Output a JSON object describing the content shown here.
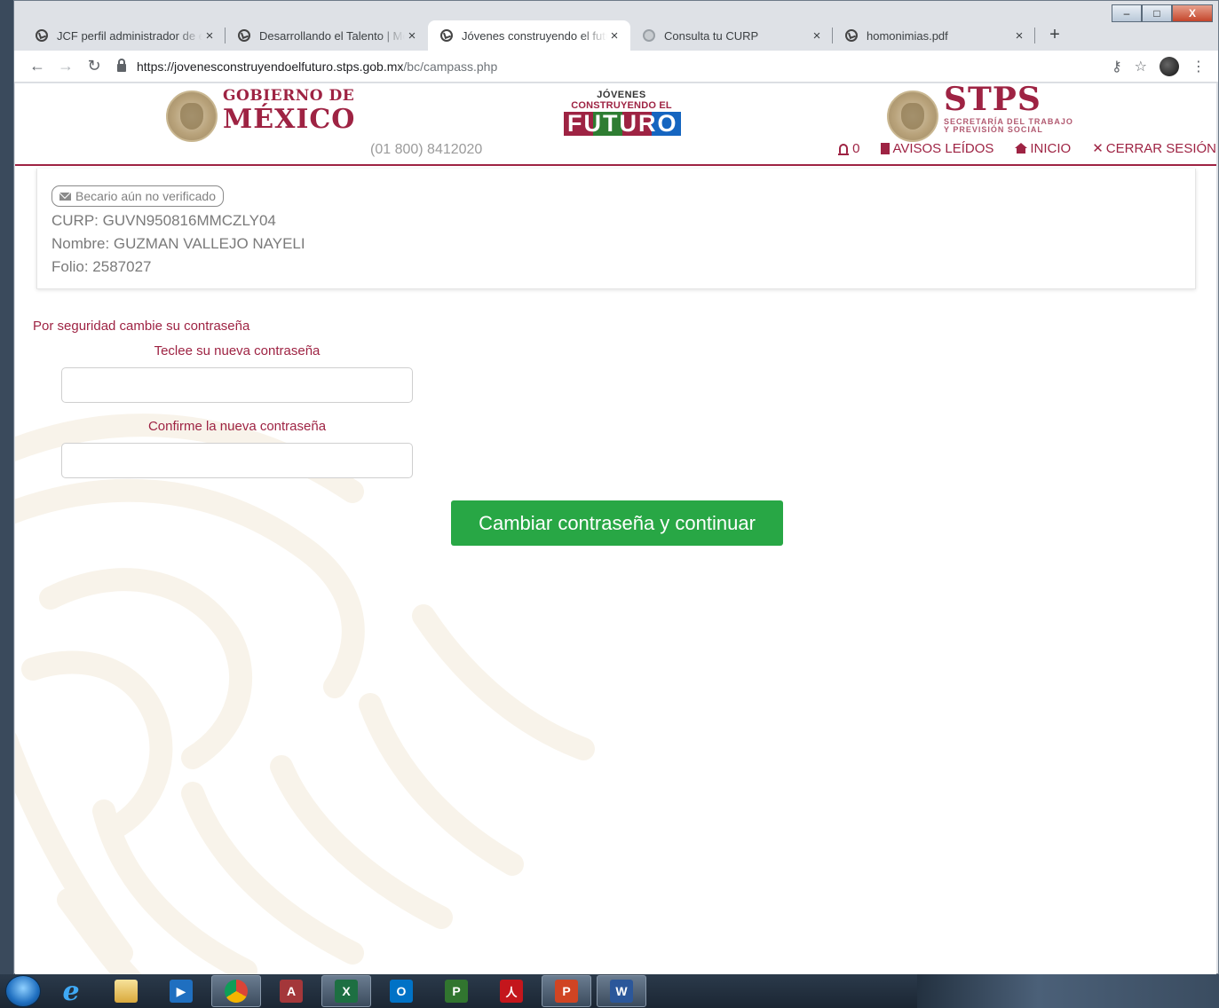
{
  "browser": {
    "tabs": [
      {
        "title": "JCF perfil administrador de e",
        "icon": "globe-check-icon",
        "active": false
      },
      {
        "title": "Desarrollando el Talento | Me",
        "icon": "globe-check-icon",
        "active": false
      },
      {
        "title": "Jóvenes construyendo el futu",
        "icon": "globe-check-icon",
        "active": true
      },
      {
        "title": "Consulta tu CURP",
        "icon": "gov-seal-icon",
        "active": false
      },
      {
        "title": "homonimias.pdf",
        "icon": "globe-check-icon",
        "active": false
      }
    ],
    "tab_close_glyph": "×",
    "new_tab_glyph": "+",
    "url_host": "https://jovenesconstruyendoelfuturo.stps.gob.mx",
    "url_path": "/bc/campass.php",
    "window_controls": {
      "minimize": "–",
      "maximize": "□",
      "close": "X"
    }
  },
  "header": {
    "gobierno_line1": "GOBIERNO DE",
    "gobierno_line2": "MÉXICO",
    "phone": "(01 800) 8412020",
    "jcf_line1": "JÓVENES",
    "jcf_line2": "CONSTRUYENDO EL",
    "jcf_line3": "FUTURO",
    "stps_title": "STPS",
    "stps_sub1": "SECRETARÍA DEL TRABAJO",
    "stps_sub2": "Y PREVISIÓN SOCIAL",
    "nav": {
      "notifications_count": "0",
      "avisos": "AVISOS LEÍDOS",
      "inicio": "INICIO",
      "cerrar": "CERRAR SESIÓN"
    }
  },
  "profile": {
    "badge": "Becario aún no verificado",
    "curp": "CURP: GUVN950816MMCZLY04",
    "nombre": "Nombre: GUZMAN VALLEJO NAYELI",
    "folio": "Folio: 2587027"
  },
  "form": {
    "note": "Por seguridad cambie su contraseña",
    "new_password_label": "Teclee su nueva contraseña",
    "new_password_value": "",
    "confirm_password_label": "Confirme la nueva contraseña",
    "confirm_password_value": "",
    "submit_label": "Cambiar contraseña y continuar"
  },
  "colors": {
    "brand": "#9e2343",
    "submit": "#28a745",
    "muted_text": "#7a7a7a"
  },
  "taskbar": {
    "apps": [
      {
        "name": "internet-explorer",
        "glyph": "e"
      },
      {
        "name": "file-explorer",
        "glyph": ""
      },
      {
        "name": "media-player",
        "glyph": ""
      },
      {
        "name": "chrome",
        "glyph": ""
      },
      {
        "name": "access",
        "glyph": "A"
      },
      {
        "name": "excel",
        "glyph": "X"
      },
      {
        "name": "outlook",
        "glyph": "O"
      },
      {
        "name": "project",
        "glyph": "P"
      },
      {
        "name": "acrobat",
        "glyph": "人"
      },
      {
        "name": "powerpoint",
        "glyph": "P"
      },
      {
        "name": "word",
        "glyph": "W"
      }
    ]
  }
}
